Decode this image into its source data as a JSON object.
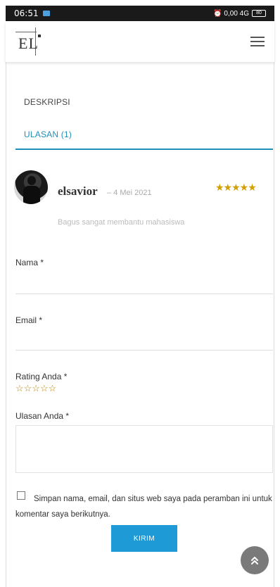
{
  "statusbar": {
    "time": "06:51",
    "right_text": "⏰ 0,00 4G",
    "battery": "80"
  },
  "header": {
    "logo_text": "EL",
    "menu_icon": "hamburger-icon"
  },
  "tabs": {
    "description": "DESKRIPSI",
    "reviews": "ULASAN (1)"
  },
  "review": {
    "author": "elsavior",
    "date": "– 4 Mei 2021",
    "stars": "★★★★★",
    "text": "Bagus sangat membantu mahasiswa"
  },
  "form": {
    "name_label": "Nama",
    "email_label": "Email",
    "rating_label": "Rating Anda",
    "review_label": "Ulasan Anda",
    "required_mark": "*",
    "empty_stars": "☆☆☆☆☆",
    "consent_text": "Simpan nama, email, dan situs web saya pada peramban ini untuk komentar saya berikutnya.",
    "submit_label": "KIRIM"
  },
  "colors": {
    "accent": "#1e90b8",
    "button": "#1e9ad6",
    "star": "#d39e00"
  }
}
